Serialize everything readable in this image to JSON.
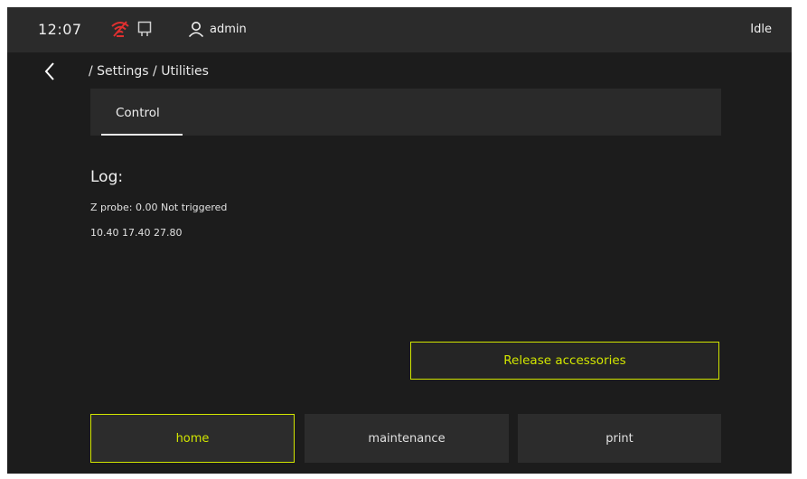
{
  "topbar": {
    "time": "12:07",
    "user": "admin",
    "status": "Idle",
    "icons": {
      "network": "wifi-disconnected-icon",
      "usb": "usb-icon",
      "user": "user-icon"
    },
    "colors": {
      "network_alert": "#e03030"
    }
  },
  "breadcrumb": {
    "text": "/ Settings / Utilities"
  },
  "tabs": [
    {
      "label": "Control",
      "active": true
    }
  ],
  "log": {
    "title": "Log:",
    "lines": [
      "Z probe: 0.00 Not triggered",
      "10.40  17.40  27.80"
    ]
  },
  "actions": {
    "release_label": "Release accessories"
  },
  "nav": {
    "home": "home",
    "maintenance": "maintenance",
    "print": "print"
  },
  "colors": {
    "accent": "#d2e600",
    "background": "#1c1c1c",
    "panel": "#2c2c2c"
  }
}
